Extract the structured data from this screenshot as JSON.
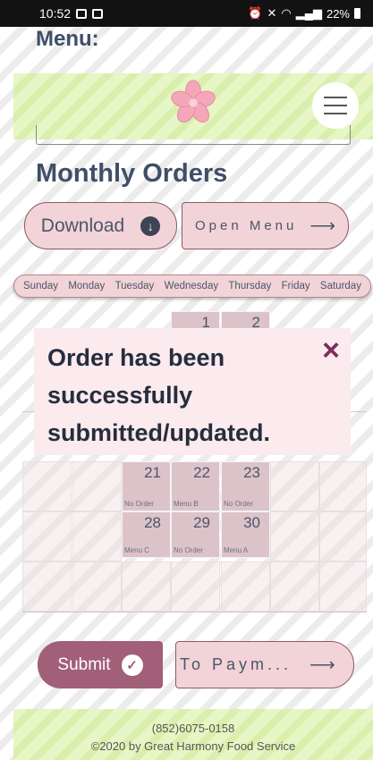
{
  "status_bar": {
    "time": "10:52",
    "battery": "22%"
  },
  "header": {
    "menu_heading": "Menu:"
  },
  "section": {
    "title": "Monthly Orders"
  },
  "buttons": {
    "download_label": "Download",
    "open_menu_label": "Open Menu",
    "submit_label": "Submit",
    "payment_label": "To Paym..."
  },
  "calendar": {
    "days": [
      "Sunday",
      "Monday",
      "Tuesday",
      "Wednesday",
      "Thursday",
      "Friday",
      "Saturday"
    ],
    "cells": [
      {
        "num": "1",
        "label": ""
      },
      {
        "num": "2",
        "label": ""
      },
      {
        "num": "21",
        "label": "No Order"
      },
      {
        "num": "22",
        "label": "Menu B"
      },
      {
        "num": "23",
        "label": "No Order"
      },
      {
        "num": "28",
        "label": "Menu C"
      },
      {
        "num": "29",
        "label": "No Order"
      },
      {
        "num": "30",
        "label": "Menu A"
      }
    ]
  },
  "toast": {
    "message": "Order has been successfully submitted/updated.",
    "close_icon": "×"
  },
  "footer": {
    "phone": "(852)6075-0158",
    "copyright": "©2020 by Great Harmony Food Service"
  },
  "colors": {
    "accent": "#a15f78",
    "pink": "#f2d3d8",
    "lime": "#e6f6c4",
    "heading": "#3f4f68"
  }
}
